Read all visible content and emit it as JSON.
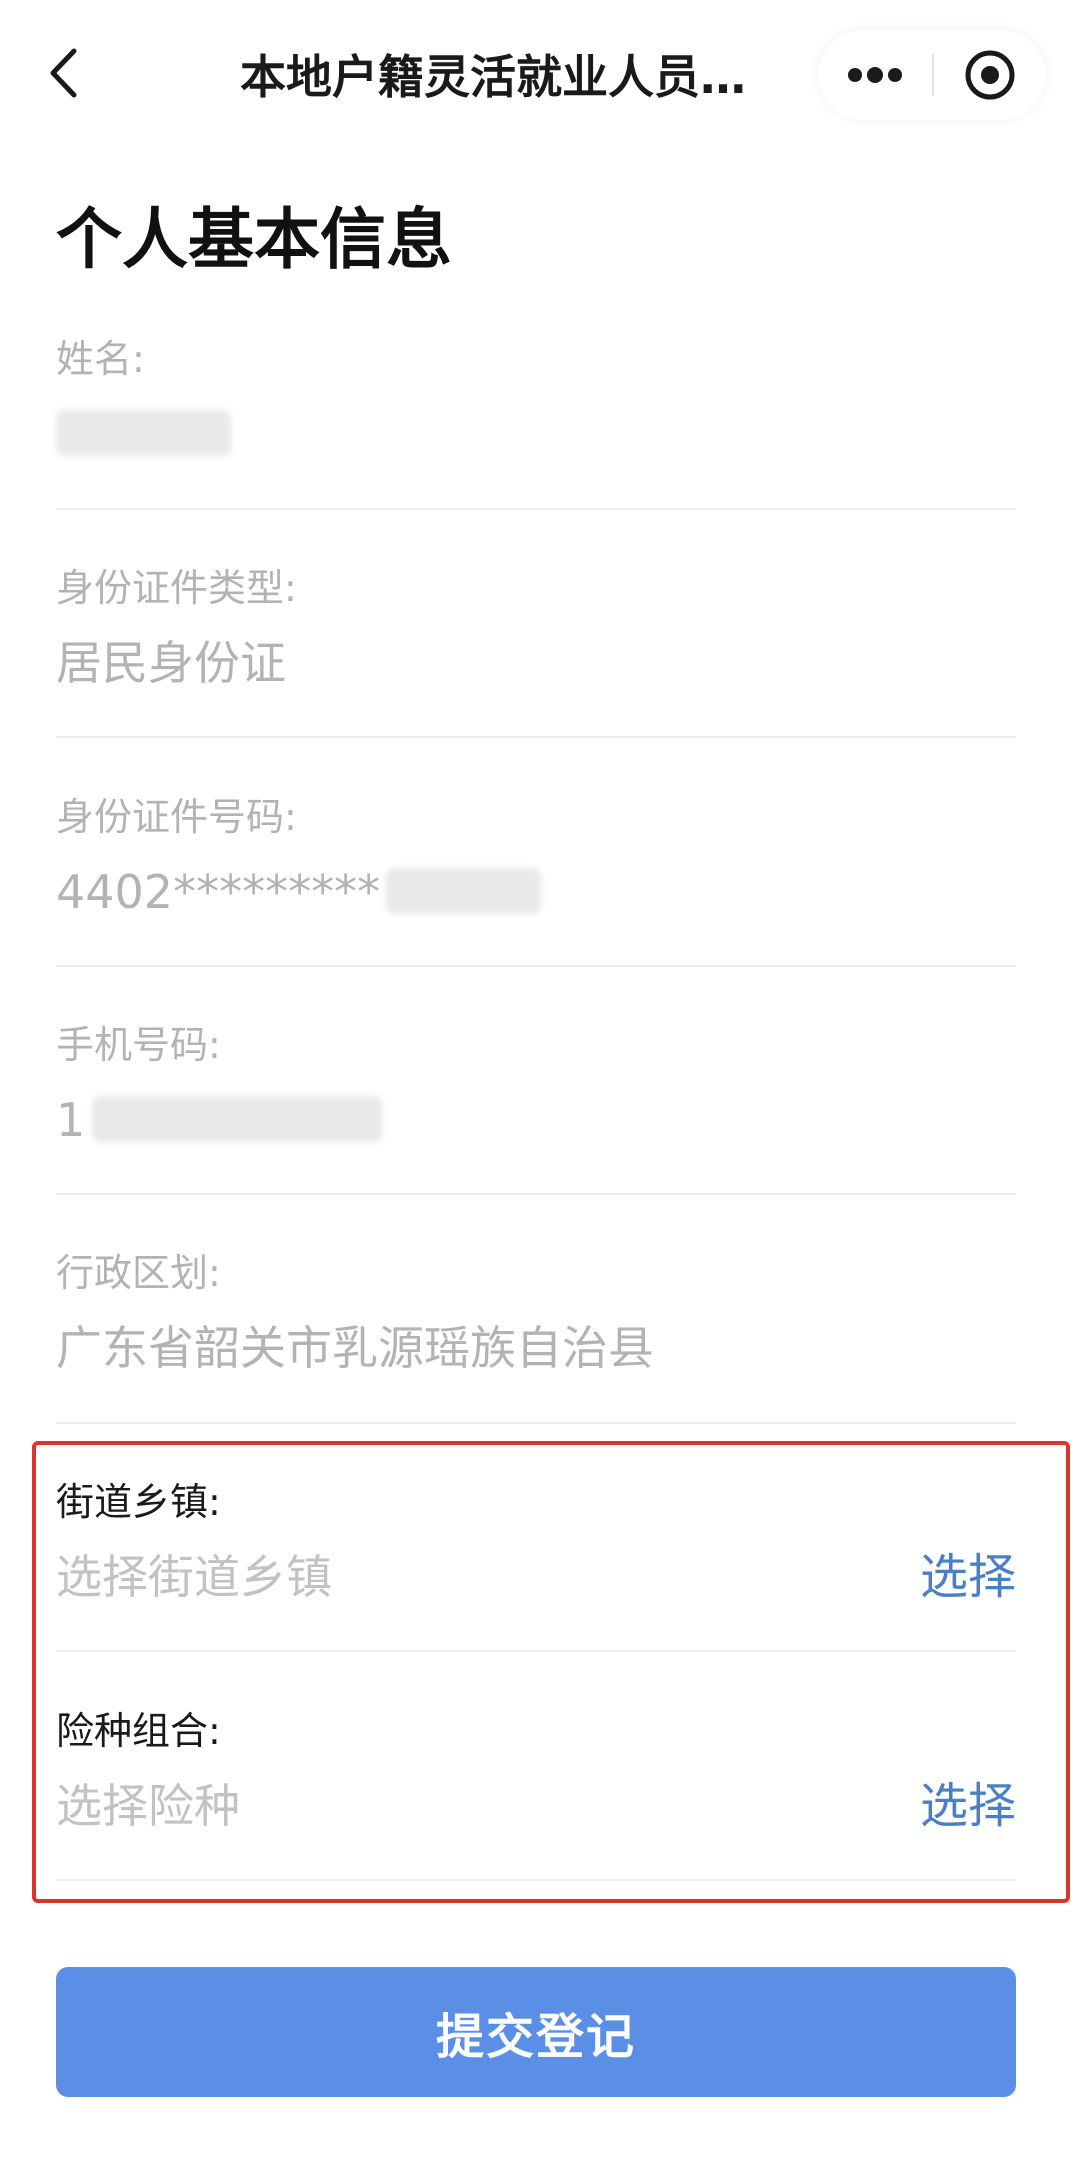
{
  "header": {
    "title": "本地户籍灵活就业人员…",
    "back_icon": "chevron-left-icon",
    "more_icon": "more-dots-icon",
    "close_icon": "target-circle-icon"
  },
  "page": {
    "title": "个人基本信息"
  },
  "fields": {
    "name": {
      "label": "姓名:",
      "value": ""
    },
    "id_type": {
      "label": "身份证件类型:",
      "value": "居民身份证"
    },
    "id_number": {
      "label": "身份证件号码:",
      "value": "4402*********"
    },
    "phone": {
      "label": "手机号码:",
      "value": "1"
    },
    "region": {
      "label": "行政区划:",
      "value": "广东省韶关市乳源瑶族自治县"
    },
    "street": {
      "label": "街道乡镇:",
      "placeholder": "选择街道乡镇",
      "action": "选择"
    },
    "insurance": {
      "label": "险种组合:",
      "placeholder": "选择险种",
      "action": "选择"
    }
  },
  "submit": {
    "label": "提交登记"
  },
  "colors": {
    "accent": "#5b8fe6",
    "link": "#4a7fc8",
    "highlight": "#d9362b",
    "muted_text": "#b3b3b3"
  }
}
